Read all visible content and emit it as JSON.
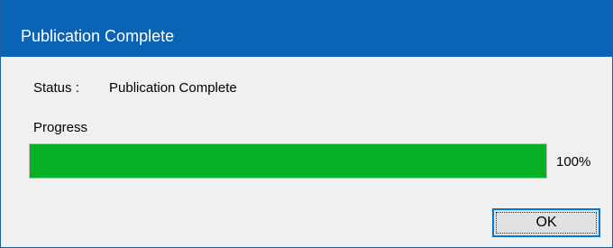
{
  "window": {
    "title": "Publication Complete",
    "titlebar_color": "#0a64b6"
  },
  "status": {
    "label": "Status :",
    "value": "Publication Complete"
  },
  "progress": {
    "label": "Progress",
    "value_percent": 100,
    "text": "100%",
    "fill_color": "#06b025"
  },
  "buttons": {
    "ok_label": "OK"
  }
}
